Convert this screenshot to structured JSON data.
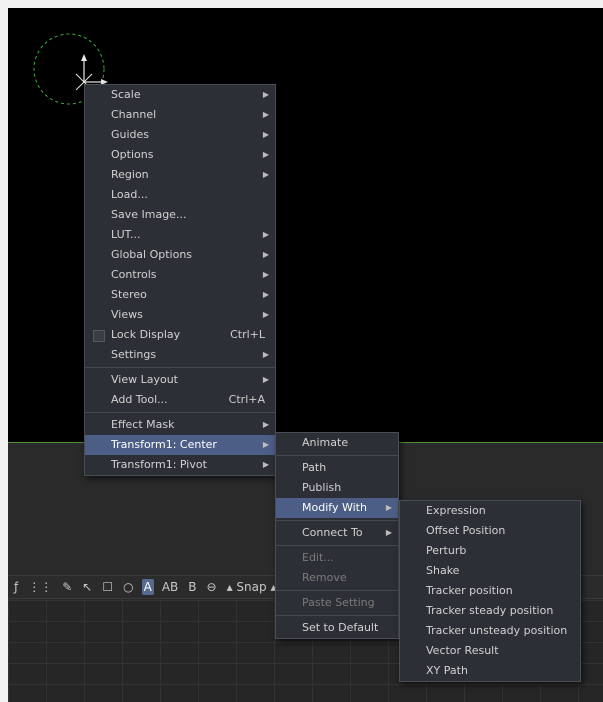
{
  "main_menu": {
    "group1": [
      {
        "label": "Scale",
        "submenu": true
      },
      {
        "label": "Channel",
        "submenu": true
      },
      {
        "label": "Guides",
        "submenu": true
      },
      {
        "label": "Options",
        "submenu": true
      },
      {
        "label": "Region",
        "submenu": true
      },
      {
        "label": "Load...",
        "submenu": false
      },
      {
        "label": "Save Image...",
        "submenu": false
      },
      {
        "label": "LUT...",
        "submenu": true
      },
      {
        "label": "Global Options",
        "submenu": true
      },
      {
        "label": "Controls",
        "submenu": true
      },
      {
        "label": "Stereo",
        "submenu": true
      },
      {
        "label": "Views",
        "submenu": true
      }
    ],
    "lock_display": {
      "label": "Lock Display",
      "shortcut": "Ctrl+L"
    },
    "settings": {
      "label": "Settings"
    },
    "view_layout": {
      "label": "View Layout"
    },
    "add_tool": {
      "label": "Add Tool...",
      "shortcut": "Ctrl+A"
    },
    "effect_mask": {
      "label": "Effect Mask"
    },
    "transform_center": {
      "label": "Transform1: Center"
    },
    "transform_pivot": {
      "label": "Transform1: Pivot"
    }
  },
  "sub_menu": {
    "animate": "Animate",
    "path": "Path",
    "publish": "Publish",
    "modify_with": "Modify With",
    "connect_to": "Connect To",
    "edit": "Edit...",
    "remove": "Remove",
    "paste_setting": "Paste Setting",
    "set_to_default": "Set to Default"
  },
  "modify_menu": [
    "Expression",
    "Offset Position",
    "Perturb",
    "Shake",
    "Tracker position",
    "Tracker steady position",
    "Tracker unsteady position",
    "Vector Result",
    "XY Path"
  ],
  "toolbar": {
    "text_a": "A",
    "text_ab": "AB",
    "text_b": "B",
    "snap_label": "Snap"
  },
  "colors": {
    "highlight": "#4d5e86",
    "menu_bg": "#2c2f36",
    "viewer_line": "#4f8f3a",
    "gizmo_circle": "#3fae3f"
  }
}
